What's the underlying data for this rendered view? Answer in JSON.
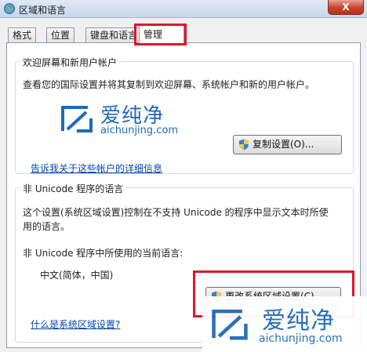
{
  "window": {
    "title": "区域和语言",
    "close_label": "X"
  },
  "tabs": [
    {
      "label": "格式"
    },
    {
      "label": "位置"
    },
    {
      "label": "键盘和语言"
    },
    {
      "label": "管理",
      "active": true
    }
  ],
  "welcome_group": {
    "title": "欢迎屏幕和新用户帐户",
    "description": "查看您的国际设置并将其复制到欢迎屏幕、系统帐户和新的用户帐户。",
    "copy_button": "复制设置(O)...",
    "link": "告诉我关于这些帐户的详细信息"
  },
  "unicode_group": {
    "title": "非 Unicode 程序的语言",
    "description_line1": "这个设置(系统区域设置)控制在不支持 Unicode 的程序中显示文本时所使",
    "description_line2": "用的语言。",
    "current_label": "非 Unicode 程序中所使用的当前语言:",
    "current_value": "中文(简体，中国)",
    "change_button": "更改系统区域设置(C)...",
    "link": "什么是系统区域设置?"
  },
  "watermark": {
    "brand": "爱纯净",
    "url": "aichunjing.com"
  },
  "colors": {
    "highlight": "#e0152a",
    "link": "#0645ad",
    "watermark": "#1e6ab8"
  }
}
